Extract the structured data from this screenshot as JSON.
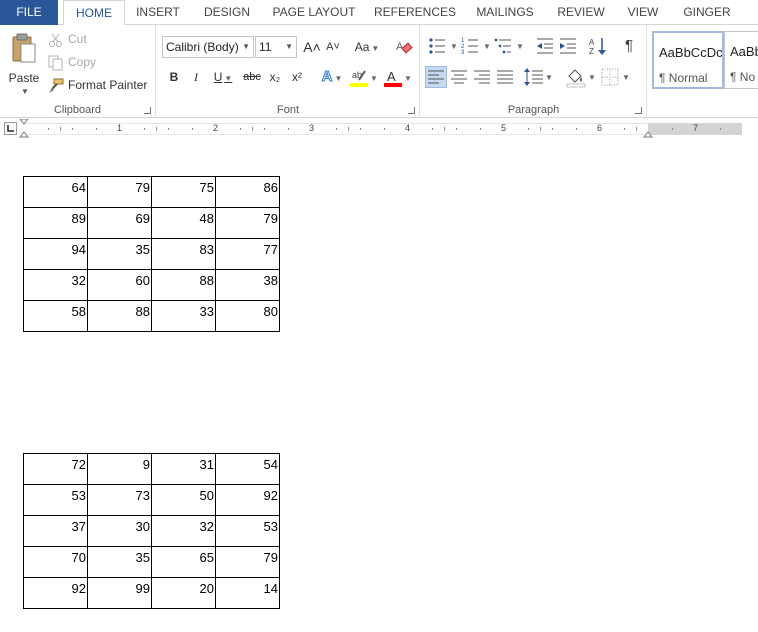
{
  "tabs": [
    "FILE",
    "HOME",
    "INSERT",
    "DESIGN",
    "PAGE LAYOUT",
    "REFERENCES",
    "MAILINGS",
    "REVIEW",
    "VIEW",
    "GINGER"
  ],
  "active_tab": "HOME",
  "clipboard": {
    "paste_label": "Paste",
    "cut_label": "Cut",
    "copy_label": "Copy",
    "format_painter_label": "Format Painter",
    "group_label": "Clipboard"
  },
  "font": {
    "font_name": "Calibri (Body)",
    "font_size": "11",
    "group_label": "Font",
    "bold": "B",
    "italic": "I",
    "underline": "U",
    "strikethrough": "abc",
    "subscript": "x₂",
    "superscript": "x²",
    "change_case": "Aa",
    "grow": "A˄",
    "shrink": "A˅",
    "highlight_color": "#ffff00",
    "font_color": "#ff0000"
  },
  "paragraph": {
    "group_label": "Paragraph",
    "pilcrow": "¶"
  },
  "styles": [
    {
      "sample": "AaBbCcDc",
      "name": "¶ Normal"
    },
    {
      "sample": "AaBbCcDc",
      "name": "¶ No Spac"
    }
  ],
  "ruler": [
    "1",
    "2",
    "3",
    "4",
    "5",
    "6",
    "7"
  ],
  "tables": [
    {
      "rows": [
        [
          "64",
          "79",
          "75",
          "86"
        ],
        [
          "89",
          "69",
          "48",
          "79"
        ],
        [
          "94",
          "35",
          "83",
          "77"
        ],
        [
          "32",
          "60",
          "88",
          "38"
        ],
        [
          "58",
          "88",
          "33",
          "80"
        ]
      ]
    },
    {
      "rows": [
        [
          "72",
          "9",
          "31",
          "54"
        ],
        [
          "53",
          "73",
          "50",
          "92"
        ],
        [
          "37",
          "30",
          "32",
          "53"
        ],
        [
          "70",
          "35",
          "65",
          "79"
        ],
        [
          "92",
          "99",
          "20",
          "14"
        ]
      ]
    }
  ],
  "colors": {
    "file_tab": "#2b579a",
    "active_tab_text": "#2b579a"
  }
}
